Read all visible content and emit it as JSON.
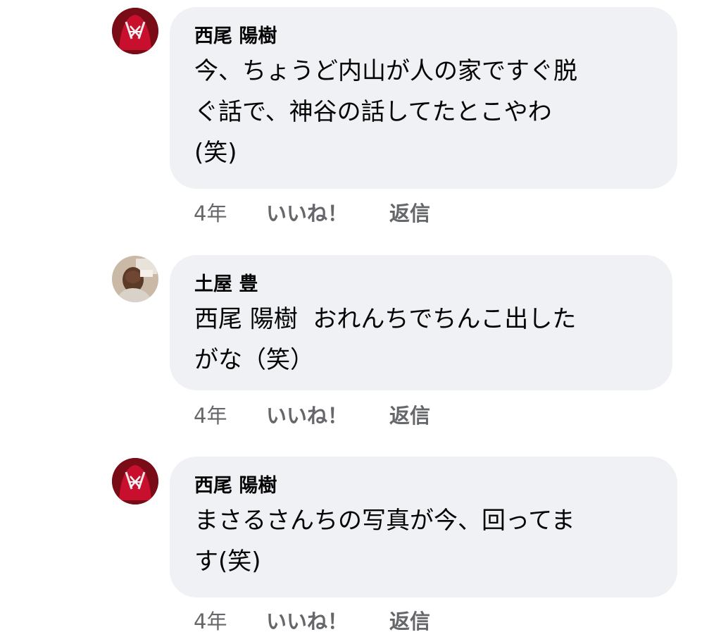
{
  "comments": [
    {
      "author": "西尾 陽樹",
      "avatar_icon": "red-glove-avatar-icon",
      "text_lines": [
        "今、ちょうど内山が人の家ですぐ脱",
        "ぐ話で、神谷の話してたとこやわ",
        "(笑)"
      ],
      "time": "4年",
      "like_label": "いいね！",
      "reply_label": "返信"
    },
    {
      "author": "土屋 豊",
      "avatar_icon": "person-photo-avatar-icon",
      "text_lines": [
        "西尾 陽樹  おれんちでちんこ出した",
        "がな（笑）"
      ],
      "time": "4年",
      "like_label": "いいね！",
      "reply_label": "返信"
    },
    {
      "author": "西尾 陽樹",
      "avatar_icon": "red-glove-avatar-icon",
      "text_lines": [
        "まさるさんちの写真が今、回ってま",
        "す(笑)"
      ],
      "time": "4年",
      "like_label": "いいね！",
      "reply_label": "返信"
    }
  ],
  "colors": {
    "bubble": "#f0f1f5",
    "meta_text": "#65676b",
    "body_text": "#050505",
    "glove_red": "#c8102e"
  }
}
